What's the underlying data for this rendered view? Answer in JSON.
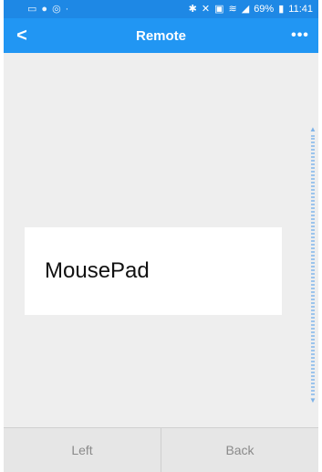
{
  "status_bar": {
    "left_icons": [
      "image-icon",
      "facebook-icon",
      "whatsapp-icon"
    ],
    "dot": "·",
    "battery_percent": "69%",
    "time": "11:41"
  },
  "app_bar": {
    "back_glyph": "<",
    "title": "Remote",
    "more_glyph": "•••"
  },
  "main": {
    "mousepad_label": "MousePad"
  },
  "bottom_bar": {
    "left_label": "Left",
    "back_label": "Back"
  },
  "colors": {
    "app_bar": "#2196f3",
    "status_bar": "#1e88e5",
    "content_bg": "#eeeeee",
    "scrollbar": "#9cc4ec"
  }
}
